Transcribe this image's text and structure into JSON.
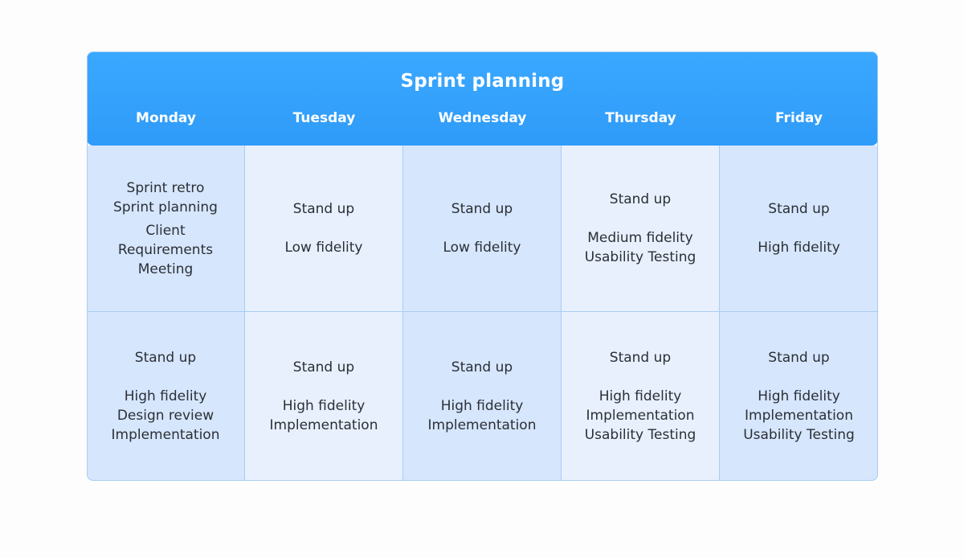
{
  "board": {
    "title": "Sprint planning",
    "days": [
      "Monday",
      "Tuesday",
      "Wednesday",
      "Thursday",
      "Friday"
    ],
    "rows": [
      [
        {
          "groups": [
            [
              "Sprint retro",
              "Sprint planning"
            ],
            [
              "Client",
              "Requirements",
              "Meeting"
            ]
          ],
          "tight": true
        },
        {
          "groups": [
            [
              "Stand up"
            ],
            [
              "Low fidelity"
            ]
          ]
        },
        {
          "groups": [
            [
              "Stand up"
            ],
            [
              "Low fidelity"
            ]
          ]
        },
        {
          "groups": [
            [
              "Stand up"
            ],
            [
              "Medium fidelity",
              "Usability Testing"
            ]
          ]
        },
        {
          "groups": [
            [
              "Stand up"
            ],
            [
              "High fidelity"
            ]
          ]
        }
      ],
      [
        {
          "groups": [
            [
              "Stand up"
            ],
            [
              "High fidelity",
              "Design review",
              "Implementation"
            ]
          ]
        },
        {
          "groups": [
            [
              "Stand up"
            ],
            [
              "High fidelity",
              "Implementation"
            ]
          ]
        },
        {
          "groups": [
            [
              "Stand up"
            ],
            [
              "High fidelity",
              "Implementation"
            ]
          ]
        },
        {
          "groups": [
            [
              "Stand up"
            ],
            [
              "High fidelity",
              "Implementation",
              "Usability Testing"
            ]
          ]
        },
        {
          "groups": [
            [
              "Stand up"
            ],
            [
              "High fidelity",
              "Implementation",
              "Usability Testing"
            ]
          ]
        }
      ]
    ]
  },
  "colors": {
    "header": "#3aa8ff",
    "column_dark": "#d6e6fd",
    "column_light": "#e8f0fe",
    "grid_line": "#a9cdf2",
    "text": "#2b2f36"
  }
}
